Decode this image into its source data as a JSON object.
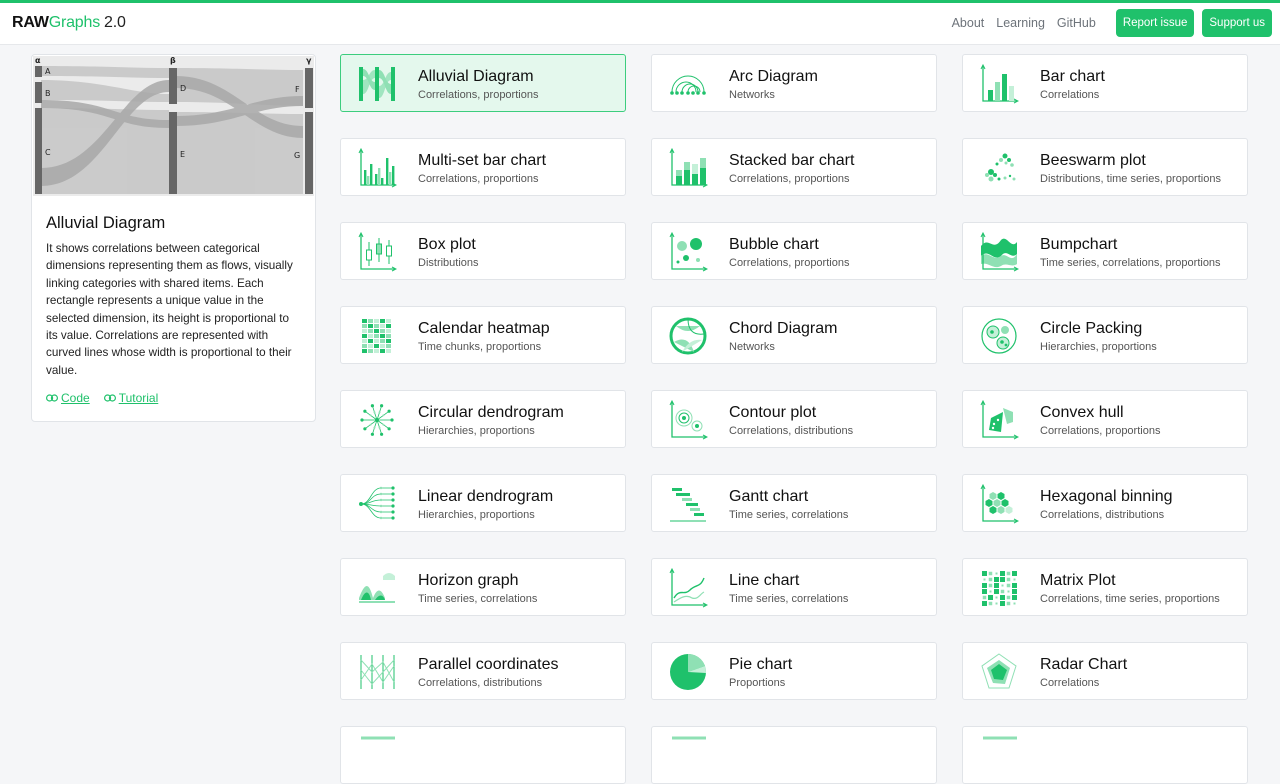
{
  "header": {
    "brand_raw": "RAW",
    "brand_graphs": "Graphs",
    "brand_version": "2.0",
    "nav": [
      "About",
      "Learning",
      "GitHub"
    ],
    "report_label": "Report issue",
    "support_label": "Support us"
  },
  "accent_color": "#1fc16b",
  "selected": {
    "preview_labels": {
      "cols": [
        "α",
        "β",
        "γ"
      ],
      "nodes": [
        "A",
        "B",
        "C",
        "D",
        "E",
        "F",
        "G"
      ]
    },
    "title": "Alluvial Diagram",
    "description": "It shows correlations between categorical dimensions representing them as flows, visually linking categories with shared items. Each rectangle represents a unique value in the selected dimension, its height is proportional to its value. Correlations are represented with curved lines whose width is proportional to their value.",
    "code_label": "Code",
    "tutorial_label": "Tutorial"
  },
  "charts": [
    {
      "name": "Alluvial Diagram",
      "tags": "Correlations, proportions",
      "icon": "alluvial-icon"
    },
    {
      "name": "Arc Diagram",
      "tags": "Networks",
      "icon": "arc-icon"
    },
    {
      "name": "Bar chart",
      "tags": "Correlations",
      "icon": "bar-icon"
    },
    {
      "name": "Multi-set bar chart",
      "tags": "Correlations, proportions",
      "icon": "multiset-bar-icon"
    },
    {
      "name": "Stacked bar chart",
      "tags": "Correlations, proportions",
      "icon": "stacked-bar-icon"
    },
    {
      "name": "Beeswarm plot",
      "tags": "Distributions, time series, proportions",
      "icon": "beeswarm-icon"
    },
    {
      "name": "Box plot",
      "tags": "Distributions",
      "icon": "boxplot-icon"
    },
    {
      "name": "Bubble chart",
      "tags": "Correlations, proportions",
      "icon": "bubble-icon"
    },
    {
      "name": "Bumpchart",
      "tags": "Time series, correlations, proportions",
      "icon": "bumpchart-icon"
    },
    {
      "name": "Calendar heatmap",
      "tags": "Time chunks, proportions",
      "icon": "calendar-icon"
    },
    {
      "name": "Chord Diagram",
      "tags": "Networks",
      "icon": "chord-icon"
    },
    {
      "name": "Circle Packing",
      "tags": "Hierarchies, proportions",
      "icon": "circle-packing-icon"
    },
    {
      "name": "Circular dendrogram",
      "tags": "Hierarchies, proportions",
      "icon": "circular-dendrogram-icon"
    },
    {
      "name": "Contour plot",
      "tags": "Correlations, distributions",
      "icon": "contour-icon"
    },
    {
      "name": "Convex hull",
      "tags": "Correlations, proportions",
      "icon": "convex-hull-icon"
    },
    {
      "name": "Linear dendrogram",
      "tags": "Hierarchies, proportions",
      "icon": "linear-dendrogram-icon"
    },
    {
      "name": "Gantt chart",
      "tags": "Time series, correlations",
      "icon": "gantt-icon"
    },
    {
      "name": "Hexagonal binning",
      "tags": "Correlations, distributions",
      "icon": "hexbin-icon"
    },
    {
      "name": "Horizon graph",
      "tags": "Time series, correlations",
      "icon": "horizon-icon"
    },
    {
      "name": "Line chart",
      "tags": "Time series, correlations",
      "icon": "line-icon"
    },
    {
      "name": "Matrix Plot",
      "tags": "Correlations, time series, proportions",
      "icon": "matrix-icon"
    },
    {
      "name": "Parallel coordinates",
      "tags": "Correlations, distributions",
      "icon": "parallel-icon"
    },
    {
      "name": "Pie chart",
      "tags": "Proportions",
      "icon": "pie-icon"
    },
    {
      "name": "Radar Chart",
      "tags": "Correlations",
      "icon": "radar-icon"
    },
    {
      "name": "",
      "tags": "",
      "icon": "partial-icon"
    },
    {
      "name": "",
      "tags": "",
      "icon": "partial-icon"
    },
    {
      "name": "",
      "tags": "",
      "icon": "partial-icon"
    }
  ]
}
